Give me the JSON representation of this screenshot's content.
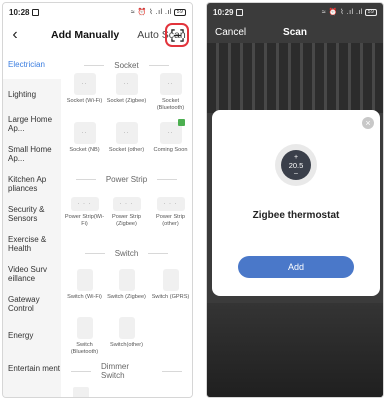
{
  "left": {
    "status": {
      "time": "10:28",
      "icons": "≈ ⏰ ⌇ .ıl .ıl",
      "battery": "59"
    },
    "header": {
      "back": "‹",
      "tab_active": "Add Manually",
      "tab_other": "Auto Scan"
    },
    "sidebar": [
      {
        "label": "Electrician",
        "active": true
      },
      {
        "label": "Lighting"
      },
      {
        "label": "Large Home Ap..."
      },
      {
        "label": "Small Home Ap..."
      },
      {
        "label": "Kitchen Ap pliances"
      },
      {
        "label": "Security & Sensors"
      },
      {
        "label": "Exercise & Health"
      },
      {
        "label": "Video Surv eillance"
      },
      {
        "label": "Gateway Control"
      },
      {
        "label": "Energy"
      },
      {
        "label": "Entertain ment"
      }
    ],
    "sections": [
      {
        "title": "Socket",
        "items": [
          "Socket (Wi-Fi)",
          "Socket (Zigbee)",
          "Socket (Bluetooth)",
          "Socket (NB)",
          "Socket (other)",
          "Coming Soon"
        ]
      },
      {
        "title": "Power Strip",
        "items": [
          "Power Strip(Wi-Fi)",
          "Power Strip (Zigbee)",
          "Power Strip (other)"
        ]
      },
      {
        "title": "Switch",
        "items": [
          "Switch (Wi-Fi)",
          "Switch (Zigbee)",
          "Switch (GPRS)",
          "Switch (Bluetooth)",
          "Switch(other)"
        ]
      },
      {
        "title": "Dimmer Switch",
        "items": []
      }
    ]
  },
  "right": {
    "status": {
      "time": "10:29",
      "icons": "≈ ⏰ ⌇ .ıl .ıl",
      "battery": "59"
    },
    "header": {
      "cancel": "Cancel",
      "title": "Scan"
    },
    "dialog": {
      "close": "×",
      "thermostat": {
        "plus": "+",
        "value": "20.5",
        "minus": "–"
      },
      "device_name": "Zigbee thermostat",
      "add_label": "Add"
    }
  },
  "colors": {
    "accent": "#3a7de0",
    "highlight": "#e2343c",
    "add_button": "#4a78c9",
    "coming_soon_badge": "#4caf50"
  }
}
